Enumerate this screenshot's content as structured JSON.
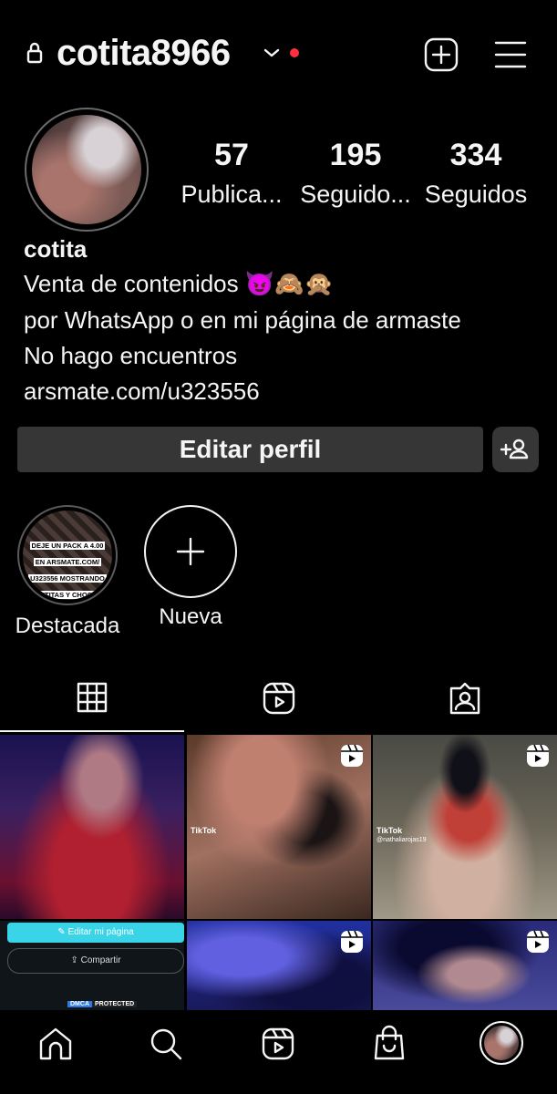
{
  "header": {
    "username": "cotita8966",
    "icons": [
      "lock-icon",
      "chevron-down-icon",
      "notification-dot",
      "new-post-icon",
      "menu-icon"
    ]
  },
  "profile": {
    "stats": [
      {
        "value": "57",
        "label": "Publica..."
      },
      {
        "value": "195",
        "label": "Seguido..."
      },
      {
        "value": "334",
        "label": "Seguidos"
      }
    ],
    "name": "cotita",
    "bio_lines": [
      "Venta de contenidos 😈🙈🙊",
      "por WhatsApp o en mi página de armaste",
      "No hago encuentros",
      "arsmate.com/u323556"
    ],
    "edit_button": "Editar perfil"
  },
  "highlights": [
    {
      "label": "Destacada",
      "cover_text": [
        "DEJE UN PACK A 4.00",
        "EN ARSMATE.COM/",
        "U323556 MOSTRANDO",
        "TETITAS Y CHOCHI"
      ]
    },
    {
      "label": "Nueva"
    }
  ],
  "tabs": [
    "grid-icon",
    "reels-icon",
    "tagged-icon"
  ],
  "posts": {
    "first_post_overlay": {
      "edit_button": "Editar mi página",
      "share_button": "Compartir",
      "badge_left": "DMCA",
      "badge_right": "PROTECTED"
    },
    "tiktok_label": "TikTok",
    "tiktok_handles": [
      "@nathaliarojas19",
      "@nathaliarojas19"
    ]
  },
  "bottom_nav": [
    "home-icon",
    "search-icon",
    "reels-icon",
    "shop-icon",
    "profile-avatar"
  ],
  "colors": {
    "background": "#000000",
    "button": "#363636",
    "notification": "#ff3040",
    "text": "#f5f5f5"
  }
}
